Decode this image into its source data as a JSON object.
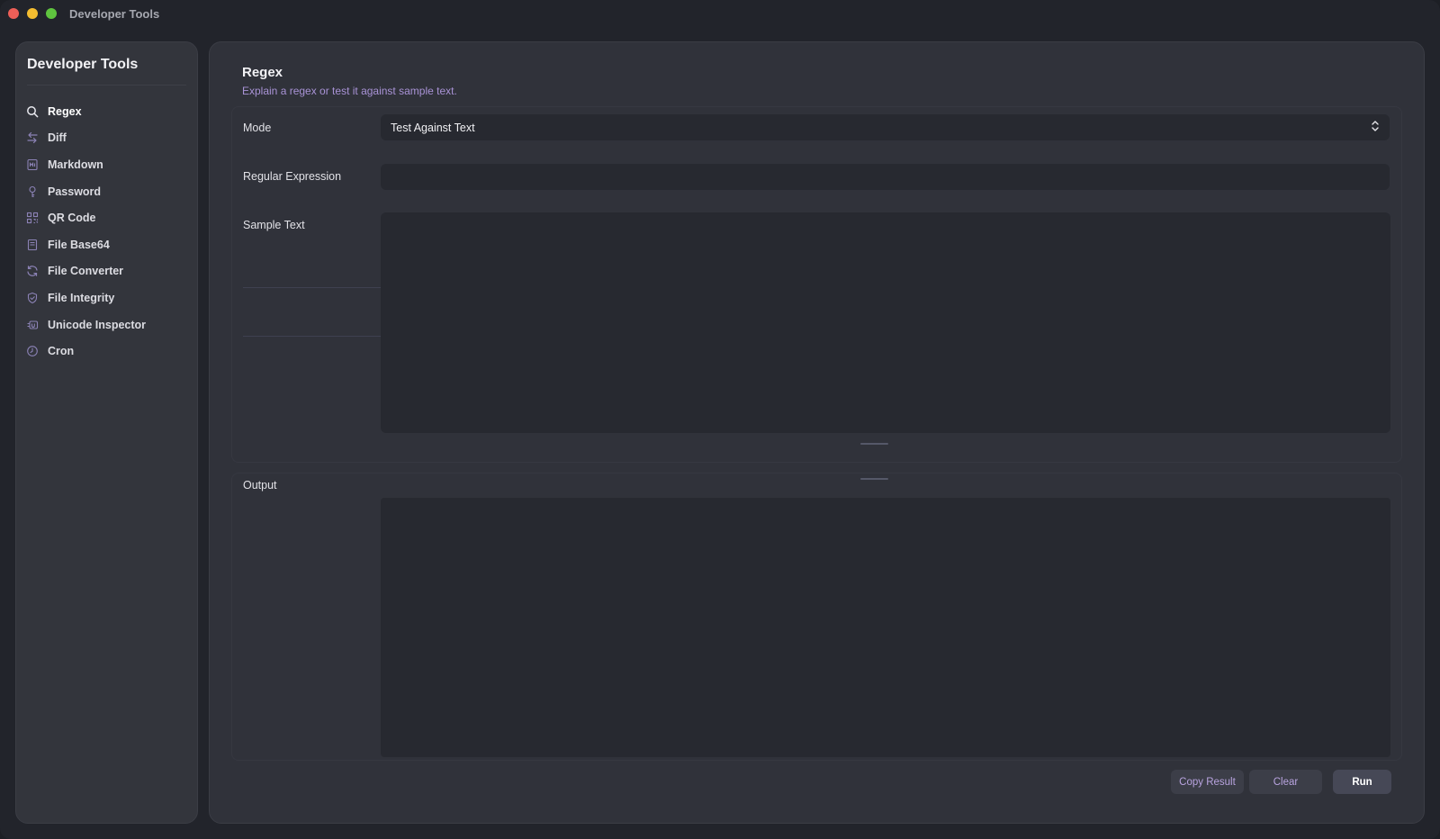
{
  "window": {
    "title": "Developer Tools"
  },
  "sidebar": {
    "title": "Developer Tools",
    "items": [
      {
        "label": "Regex",
        "icon": "search-icon",
        "active": true
      },
      {
        "label": "Diff",
        "icon": "swap-arrows-icon"
      },
      {
        "label": "Markdown",
        "icon": "markdown-doc-icon"
      },
      {
        "label": "Password",
        "icon": "key-icon"
      },
      {
        "label": "QR Code",
        "icon": "qr-code-icon"
      },
      {
        "label": "File Base64",
        "icon": "file-icon"
      },
      {
        "label": "File Converter",
        "icon": "refresh-icon"
      },
      {
        "label": "File Integrity",
        "icon": "shield-icon"
      },
      {
        "label": "Unicode Inspector",
        "icon": "unicode-icon"
      },
      {
        "label": "Cron",
        "icon": "clock-icon"
      }
    ]
  },
  "main": {
    "title": "Regex",
    "subtitle": "Explain a regex or test it against sample text.",
    "mode": {
      "label": "Mode",
      "value": "Test Against Text"
    },
    "regex": {
      "label": "Regular Expression",
      "value": "",
      "placeholder": ""
    },
    "sample": {
      "label": "Sample Text",
      "value": "",
      "placeholder": ""
    },
    "output": {
      "label": "Output",
      "value": ""
    },
    "buttons": {
      "copy": "Copy Result",
      "clear": "Clear",
      "run": "Run"
    }
  },
  "colors": {
    "accent": "#a993d6",
    "background": "#22242b",
    "panel": "#30323a",
    "field": "#272930"
  }
}
